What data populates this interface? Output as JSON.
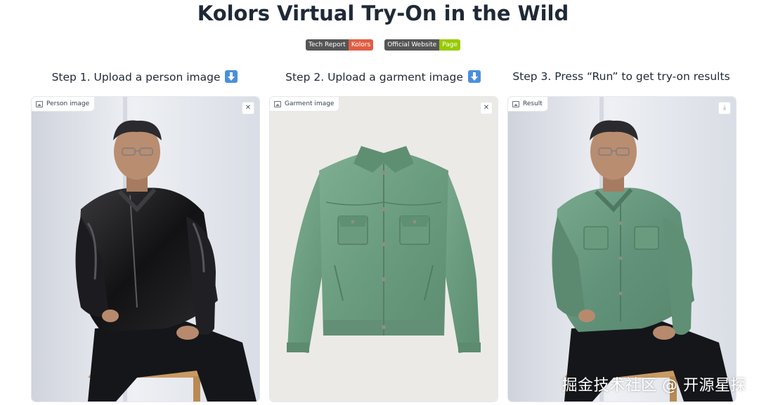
{
  "page": {
    "title": "Kolors Virtual Try-On in the Wild"
  },
  "badges": [
    {
      "left": "Tech Report",
      "right": "Kolors",
      "color": "#e05d44"
    },
    {
      "left": "Official Website",
      "right": "Page",
      "color": "#97ca00"
    }
  ],
  "steps": [
    {
      "label": "Step 1. Upload a person image",
      "icon": "down-arrow-icon"
    },
    {
      "label": "Step 2. Upload a garment image",
      "icon": "down-arrow-icon"
    },
    {
      "label": "Step 3. Press “Run” to get try-on results"
    }
  ],
  "panels": {
    "person": {
      "label": "Person image",
      "action_icon": "close-icon",
      "action_glyph": "✕"
    },
    "garment": {
      "label": "Garment image",
      "action_icon": "close-icon",
      "action_glyph": "✕"
    },
    "result": {
      "label": "Result",
      "action_icon": "download-icon",
      "action_glyph": "⤓"
    }
  },
  "watermark": "掘金技术社区 @ 开源星探",
  "colors": {
    "leather_jacket": "#1b1b1d",
    "green_suede": "#6fa184",
    "backdrop": "#e8ebf0",
    "skin": "#b78a6d"
  }
}
